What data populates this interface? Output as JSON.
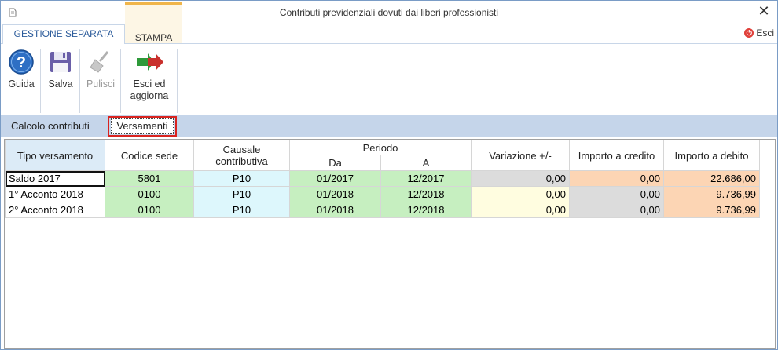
{
  "window": {
    "title": "Contributi previdenziali dovuti dai liberi professionisti",
    "close_glyph": "✕"
  },
  "ribbon_tabs": {
    "active": "GESTIONE SEPARATA",
    "other": "STAMPA",
    "exit_label": "Esci"
  },
  "ribbon": {
    "guida": "Guida",
    "salva": "Salva",
    "pulisci": "Pulisci",
    "esci_line1": "Esci ed",
    "esci_line2": "aggiorna"
  },
  "subtabs": {
    "calcolo": "Calcolo contributi",
    "versamenti": "Versamenti"
  },
  "table": {
    "headers": {
      "tipo": "Tipo versamento",
      "codice": "Codice sede",
      "causale_line1": "Causale",
      "causale_line2": "contributiva",
      "periodo": "Periodo",
      "da": "Da",
      "a": "A",
      "variazione": "Variazione +/-",
      "credito": "Importo a credito",
      "debito": "Importo a debito"
    },
    "rows": [
      {
        "tipo": "Saldo 2017",
        "codice": "5801",
        "causale": "P10",
        "da": "01/2017",
        "a": "12/2017",
        "variazione": "0,00",
        "credito": "0,00",
        "debito": "22.686,00"
      },
      {
        "tipo": "1° Acconto 2018",
        "codice": "0100",
        "causale": "P10",
        "da": "01/2018",
        "a": "12/2018",
        "variazione": "0,00",
        "credito": "0,00",
        "debito": "9.736,99"
      },
      {
        "tipo": "2° Acconto 2018",
        "codice": "0100",
        "causale": "P10",
        "da": "01/2018",
        "a": "12/2018",
        "variazione": "0,00",
        "credito": "0,00",
        "debito": "9.736,99"
      }
    ]
  },
  "colors": {
    "highlight_box": "#d9231f",
    "ribbon_accent": "#f0b54a",
    "subtab_bar": "#c5d5ea"
  }
}
